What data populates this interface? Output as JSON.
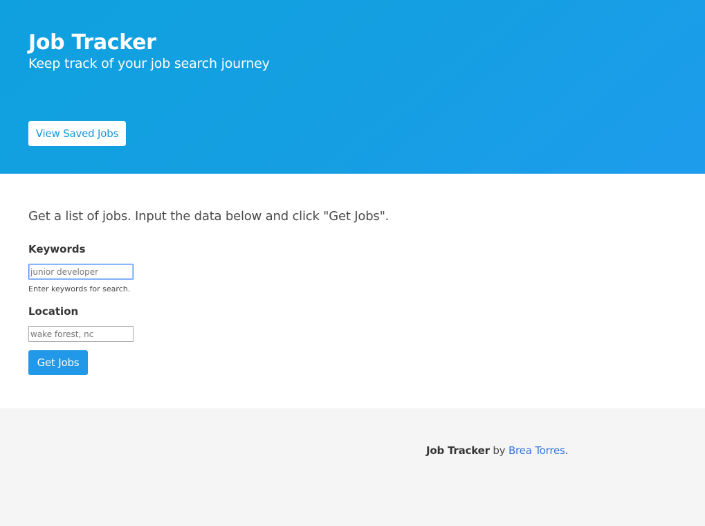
{
  "hero": {
    "title": "Job Tracker",
    "subtitle": "Keep track of your job search journey",
    "saved_button_label": "View Saved Jobs"
  },
  "form": {
    "intro": "Get a list of jobs. Input the data below and click \"Get Jobs\".",
    "keywords": {
      "label": "Keywords",
      "value": "",
      "placeholder": "junior developer",
      "help": "Enter keywords for search."
    },
    "location": {
      "label": "Location",
      "value": "",
      "placeholder": "wake forest, nc"
    },
    "submit_label": "Get Jobs"
  },
  "footer": {
    "brand": "Job Tracker",
    "by_text": " by ",
    "author": "Brea Torres",
    "end_punct": "."
  },
  "colors": {
    "hero_gradient_start": "#0fa0df",
    "hero_gradient_end": "#1e9ced",
    "primary_button": "#2299e8",
    "link": "#3273dc",
    "footer_bg": "#f5f5f5"
  }
}
